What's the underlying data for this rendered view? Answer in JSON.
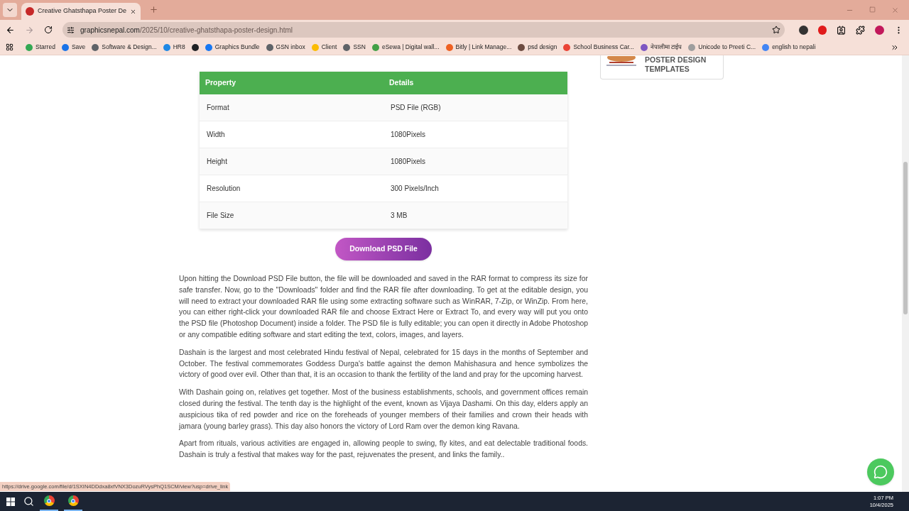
{
  "browser": {
    "tab": {
      "title": "Creative Ghatsthapa Poster De",
      "selected": true
    },
    "address": {
      "domain": "graphicsnepal.com",
      "path": "/2025/10/creative-ghatsthapa-poster-design.html"
    },
    "bookmarks": [
      {
        "label": "Starred",
        "color": "#34a853"
      },
      {
        "label": "Save",
        "color": "#1a73e8"
      },
      {
        "label": "Software & Design...",
        "color": "#5f6368"
      },
      {
        "label": "HR8",
        "color": "#1e88e5"
      },
      {
        "color": "#202124"
      },
      {
        "label": "Graphics Bundle",
        "color": "#1877f2"
      },
      {
        "label": "GSN inbox",
        "color": "#5f6368"
      },
      {
        "label": "Client",
        "color": "#fbbc04"
      },
      {
        "label": "SSN",
        "color": "#5f6368"
      },
      {
        "label": "eSewa | Digital wall...",
        "color": "#43a047"
      },
      {
        "label": "Bitly | Link Manage...",
        "color": "#ee6123"
      },
      {
        "label": "psd design",
        "color": "#6d4c41"
      },
      {
        "label": "School Business Car...",
        "color": "#ea4335"
      },
      {
        "label": "नेपालीमा टाईप",
        "color": "#7e57c2"
      },
      {
        "label": "Unicode to Preeti C...",
        "color": "#9e9e9e"
      },
      {
        "label": "english to nepali",
        "color": "#4285f4"
      }
    ]
  },
  "sidebar": {
    "card_title": "POSTER DESIGN TEMPLATES"
  },
  "table": {
    "columns": [
      "Property",
      "Details"
    ],
    "rows": [
      [
        "Format",
        "PSD File (RGB)"
      ],
      [
        "Width",
        "1080Pixels"
      ],
      [
        "Height",
        "1080Pixels"
      ],
      [
        "Resolution",
        "300 Pixels/Inch"
      ],
      [
        "File Size",
        "3 MB"
      ]
    ]
  },
  "download_button": "Download PSD File",
  "paragraphs": [
    "Upon hitting the Download PSD File button, the file will be downloaded and saved in the RAR format to compress its size for safe transfer. Now, go to the \"Downloads\" folder and find the RAR file after downloading. To get at the editable design, you will need to extract your downloaded RAR file using some extracting software such as WinRAR, 7-Zip, or WinZip. From here, you can either right-click your downloaded RAR file and choose Extract Here or Extract To, and every way will put you onto the PSD file (Photoshop Document) inside a folder. The PSD file is fully editable; you can open it directly in Adobe Photoshop or any compatible editing software and start editing the text, colors, images, and layers.",
    "Dashain is the largest and most celebrated Hindu festival of Nepal, celebrated for 15 days in the months of September and October. The festival commemorates Goddess Durga's battle against the demon Mahishasura and hence symbolizes the victory of good over evil. Other than that, it is an occasion to thank the fertility of the land and pray for the upcoming harvest.",
    "With Dashain going on, relatives get together. Most of the business establishments, schools, and government offices remain closed during the festival. The tenth day is the highlight of the event, known as Vijaya Dashami. On this day, elders apply an auspicious tika of red powder and rice on the foreheads of younger members of their families and crown their heads with jamara (young barley grass). This day also honors the victory of Lord Ram over the demon king Ravana.",
    "Apart from rituals, various activities are engaged in, allowing people to swing, fly kites, and eat delectable traditional foods. Dashain is truly a festival that makes way for the past, rejuvenates the present, and links the family.."
  ],
  "status_link": "https://drive.google.com/file/d/1SXIN4DDdxa8xfVNX3DozuRVysPhQ1SCM/view?usp=drive_link",
  "taskbar": {
    "time": "1:07 PM",
    "date": "10/4/2025"
  }
}
